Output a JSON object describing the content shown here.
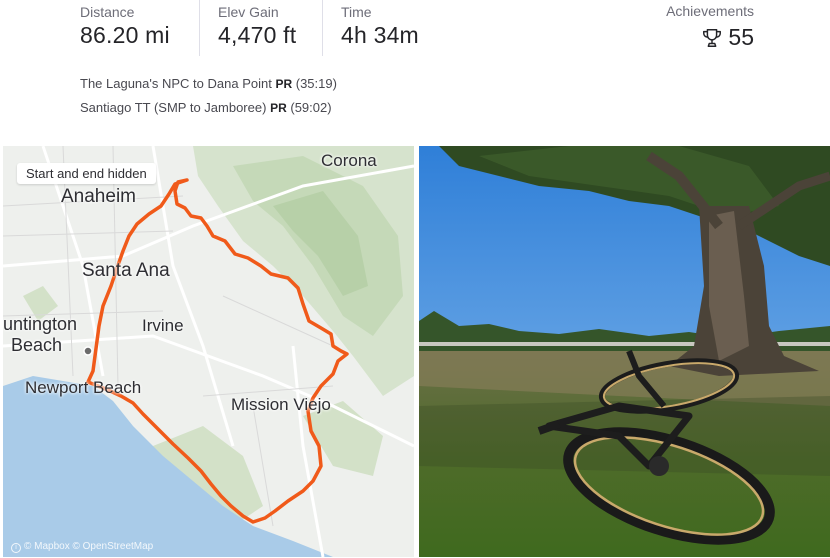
{
  "stats": [
    {
      "label": "Distance",
      "value": "86.20 mi"
    },
    {
      "label": "Elev Gain",
      "value": "4,470 ft"
    },
    {
      "label": "Time",
      "value": "4h 34m"
    }
  ],
  "achievements": {
    "label": "Achievements",
    "value": "55",
    "icon": "trophy-icon"
  },
  "prs": [
    {
      "segment": "The Laguna's NPC to Dana Point",
      "badge": "PR",
      "time": "(35:19)"
    },
    {
      "segment": "Santiago TT (SMP to Jamboree)",
      "badge": "PR",
      "time": "(59:02)"
    }
  ],
  "map": {
    "hidden_label": "Start and end hidden",
    "places": {
      "corona": "Corona",
      "anaheim": "Anaheim",
      "santa_ana": "Santa Ana",
      "huntington": "untington",
      "beach": "Beach",
      "irvine": "Irvine",
      "newport": "Newport Beach",
      "mission_viejo": "Mission Viejo"
    },
    "attribution": "© Mapbox © OpenStreetMap",
    "route_color": "#f05a1a"
  },
  "photo": {
    "alt": "Road bike lying on grass under a large oak tree in a park"
  }
}
